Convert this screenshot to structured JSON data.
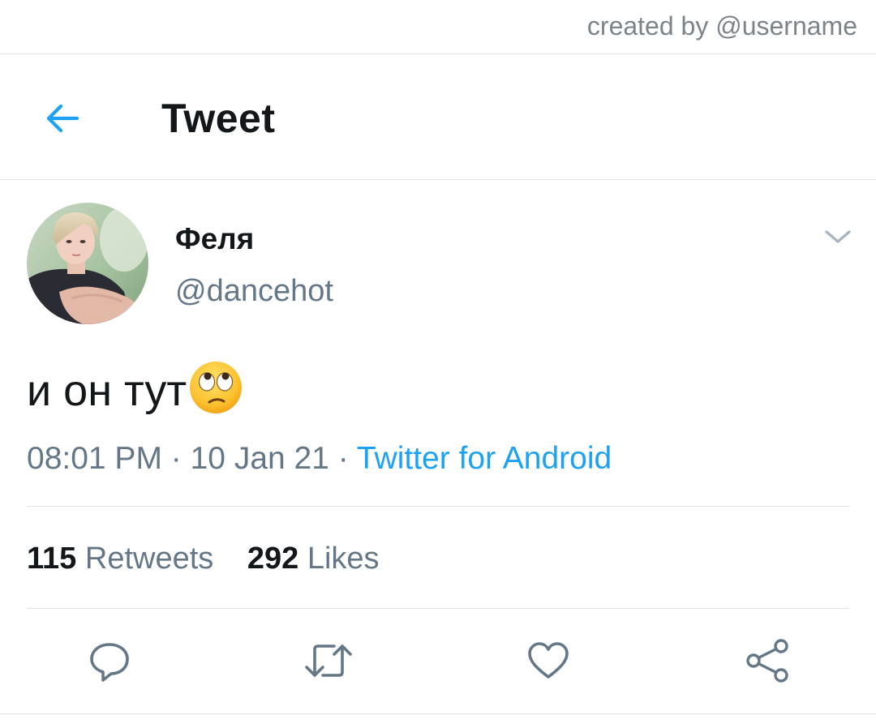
{
  "watermark": "created by @username",
  "header": {
    "title": "Tweet",
    "back_icon": "back-arrow-icon"
  },
  "tweet": {
    "author": {
      "display_name": "Феля",
      "handle": "@dancehot"
    },
    "text": "и он тут",
    "emoji": "face-with-rolling-eyes",
    "time": "08:01 PM",
    "separator": " · ",
    "date": "10 Jan 21",
    "source": "Twitter for Android",
    "stats": {
      "retweets_count": "115",
      "retweets_label": "Retweets",
      "likes_count": "292",
      "likes_label": "Likes"
    },
    "actions": [
      "reply-icon",
      "retweet-icon",
      "like-icon",
      "share-icon"
    ]
  },
  "colors": {
    "accent": "#1da1f2",
    "text_primary": "#14171a",
    "text_secondary": "#657786",
    "divider": "#dfe3e6"
  }
}
